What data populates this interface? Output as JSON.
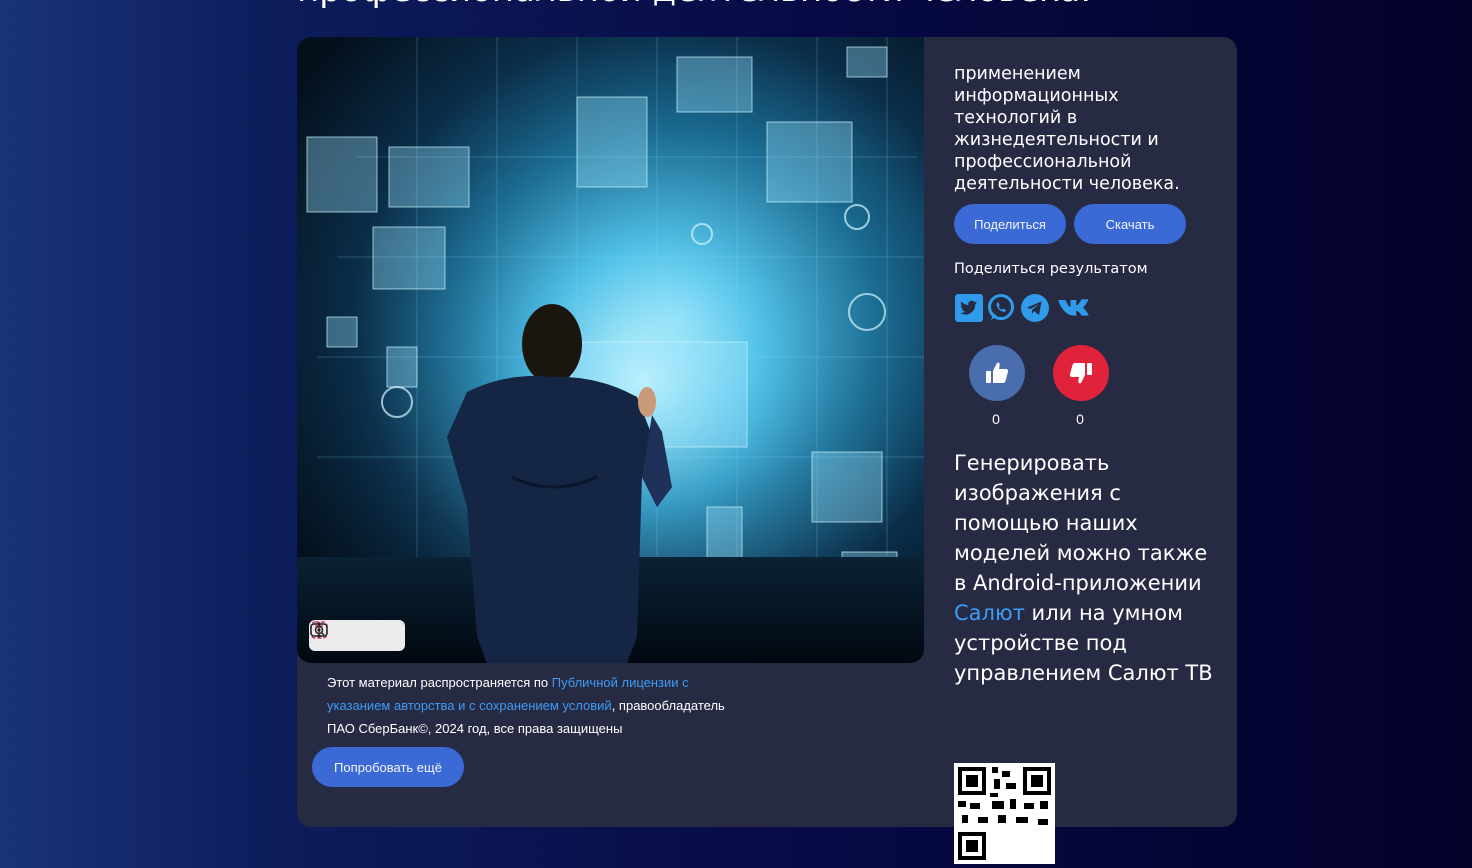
{
  "page": {
    "top_title": "профессиональной деятельности человека."
  },
  "image_toolbar": {
    "icons": [
      "text-recognition-icon",
      "visual-search-icon",
      "more-vertical-icon"
    ]
  },
  "license": {
    "prefix": "Этот материал распространяется по ",
    "link_text": "Публичной лицензии с указанием авторства и с сохранением условий",
    "suffix": ", правообладатель ПАО СберБанк©, 2024 год, все права защищены"
  },
  "try_again_label": "Попробовать ещё",
  "side": {
    "description": "применением информационных технологий в жизнедеятельности и профессиональной деятельности человека.",
    "share_button": "Поделиться",
    "download_button": "Скачать",
    "share_result_title": "Поделиться результатом",
    "social": [
      "twitter-icon",
      "whatsapp-icon",
      "telegram-icon",
      "vk-icon"
    ],
    "like_count": "0",
    "dislike_count": "0",
    "promo_prefix": "Генерировать изображения с помощью наших моделей можно также в Android-приложении ",
    "promo_link": "Салют",
    "promo_suffix": " или на умном устройстве под управлением Салют ТВ"
  },
  "colors": {
    "accent_button": "#3b6ad6",
    "link": "#3d9cf5",
    "card_bg": "#272a43",
    "like": "#4a6dae",
    "dislike": "#e0233b"
  }
}
